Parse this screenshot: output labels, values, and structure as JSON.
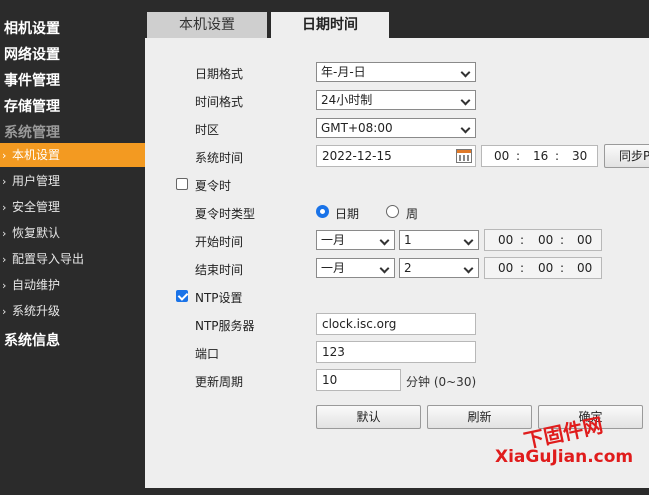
{
  "sidebar": {
    "main_items": [
      "相机设置",
      "网络设置",
      "事件管理",
      "存储管理",
      "系统管理"
    ],
    "sub_items": [
      "本机设置",
      "用户管理",
      "安全管理",
      "恢复默认",
      "配置导入导出",
      "自动维护",
      "系统升级"
    ],
    "active_sub": "本机设置",
    "bottom_item": "系统信息"
  },
  "tabs": [
    "本机设置",
    "日期时间"
  ],
  "active_tab": "日期时间",
  "form": {
    "date_format_label": "日期格式",
    "date_format_value": "年-月-日",
    "time_format_label": "时间格式",
    "time_format_value": "24小时制",
    "timezone_label": "时区",
    "timezone_value": "GMT+08:00",
    "system_time_label": "系统时间",
    "system_date": "2022-12-15",
    "system_time": {
      "h": "00",
      "m": "16",
      "s": "30"
    },
    "sync_pc_label": "同步PC",
    "dst": {
      "label": "夏令时",
      "checked": false,
      "type_label": "夏令时类型",
      "type_options": [
        "日期",
        "周"
      ],
      "type_selected": "日期",
      "start_label": "开始时间",
      "start_month": "一月",
      "start_day": "1",
      "start_time": {
        "h": "00",
        "m": "00",
        "s": "00"
      },
      "end_label": "结束时间",
      "end_month": "一月",
      "end_day": "2",
      "end_time": {
        "h": "00",
        "m": "00",
        "s": "00"
      }
    },
    "ntp": {
      "label": "NTP设置",
      "checked": true,
      "server_label": "NTP服务器",
      "server_value": "clock.isc.org",
      "port_label": "端口",
      "port_value": "123",
      "period_label": "更新周期",
      "period_value": "10",
      "period_unit": "分钟 (0~30)"
    },
    "buttons": {
      "default": "默认",
      "refresh": "刷新",
      "confirm": "确定"
    }
  },
  "watermark": {
    "cn": "下固件网",
    "en": "XiaGuJian.com"
  },
  "colors": {
    "accent_active": "#f39a21",
    "sidebar_bg": "#2b2b2b",
    "content_bg": "#eeeeee",
    "checkbox_blue": "#1a73e8",
    "watermark_red": "#e01c1c"
  }
}
